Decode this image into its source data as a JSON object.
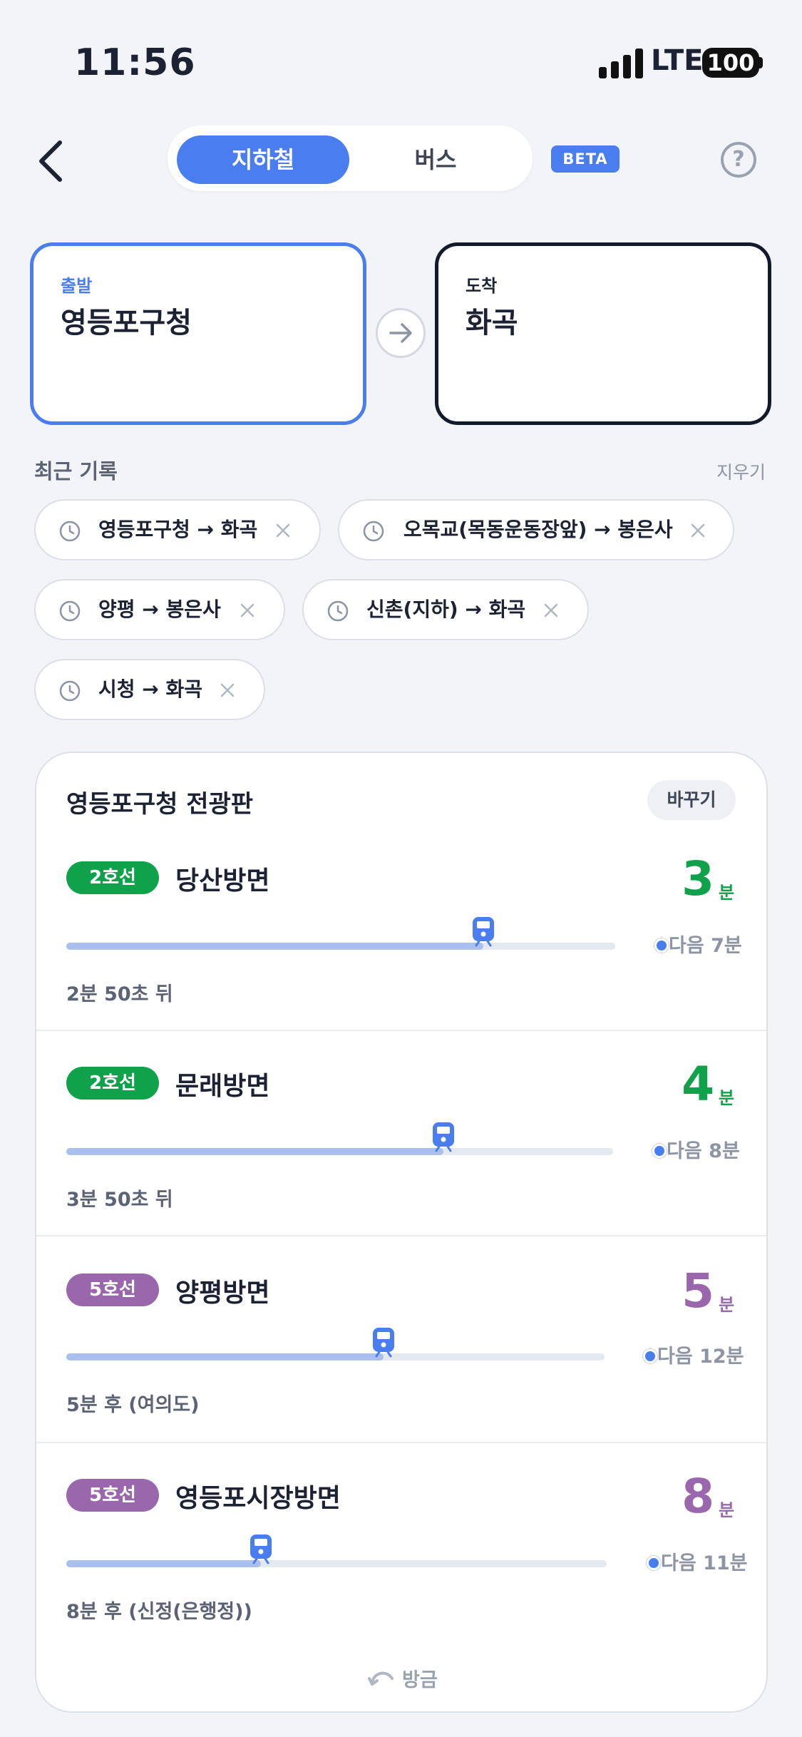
{
  "status_bar": {
    "time": "11:56",
    "network": "LTE",
    "battery": "100"
  },
  "header": {
    "tabs": [
      {
        "label": "지하철",
        "active": true
      },
      {
        "label": "버스",
        "active": false
      }
    ],
    "beta_label": "BETA",
    "help_label": "?",
    "accent_color": "#4a7ef0"
  },
  "route": {
    "departure": {
      "label": "출발",
      "station": "영등포구청"
    },
    "arrival": {
      "label": "도착",
      "station": "화곡"
    }
  },
  "recent": {
    "title": "최근 기록",
    "clear_label": "지우기",
    "chips": [
      {
        "text": "영등포구청 → 화곡"
      },
      {
        "text": "오목교(목동운동장앞) → 봉은사"
      },
      {
        "text": "양평 → 봉은사"
      },
      {
        "text": "신촌(지하) → 화곡"
      },
      {
        "text": "시청 → 화곡"
      }
    ]
  },
  "board": {
    "title": "영등포구청 전광판",
    "change_label": "바꾸기",
    "unit": "분",
    "rows": [
      {
        "line": "2호선",
        "line_color": "#0fa24a",
        "direction": "당산방면",
        "minutes": "3",
        "next": "다음 7분",
        "sub": "2분 50초 뒤",
        "progress": 0.76
      },
      {
        "line": "2호선",
        "line_color": "#0fa24a",
        "direction": "문래방면",
        "minutes": "4",
        "next": "다음 8분",
        "sub": "3분 50초 뒤",
        "progress": 0.69
      },
      {
        "line": "5호선",
        "line_color": "#9a67ad",
        "direction": "양평방면",
        "minutes": "5",
        "next": "다음 12분",
        "sub": "5분 후 (여의도)",
        "progress": 0.59
      },
      {
        "line": "5호선",
        "line_color": "#9a67ad",
        "direction": "영등포시장방면",
        "minutes": "8",
        "next": "다음 11분",
        "sub": "8분 후 (신정(은행정))",
        "progress": 0.36
      }
    ],
    "refresh_label": "방금"
  }
}
